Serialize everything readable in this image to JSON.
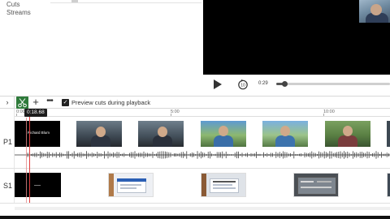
{
  "sidebar": {
    "items": [
      {
        "label": "Cuts"
      },
      {
        "label": "Streams"
      }
    ]
  },
  "player": {
    "current_time": "0:29",
    "progress": 0.07
  },
  "toolbar": {
    "expand_glyph": "›",
    "add_glyph": "+",
    "more_glyph": "•••",
    "preview_checkbox_checked": true,
    "preview_label": "Preview cuts during playback"
  },
  "timeline": {
    "playhead_time": "0:18.68",
    "ruler_ticks": [
      "0:00",
      "5:00",
      "10:00"
    ],
    "tracks": [
      {
        "label": "P1",
        "title_card_text": "Richard Blum"
      },
      {
        "label": "S1"
      }
    ]
  },
  "colors": {
    "accent_green": "#2e7a3a",
    "playhead_red": "#e33d3d",
    "video_bg": "#000000"
  },
  "icons": [
    "play-icon",
    "replay-10-icon",
    "scissors-icon",
    "plus-icon",
    "more-icon",
    "check-icon",
    "chevron-right-icon"
  ]
}
